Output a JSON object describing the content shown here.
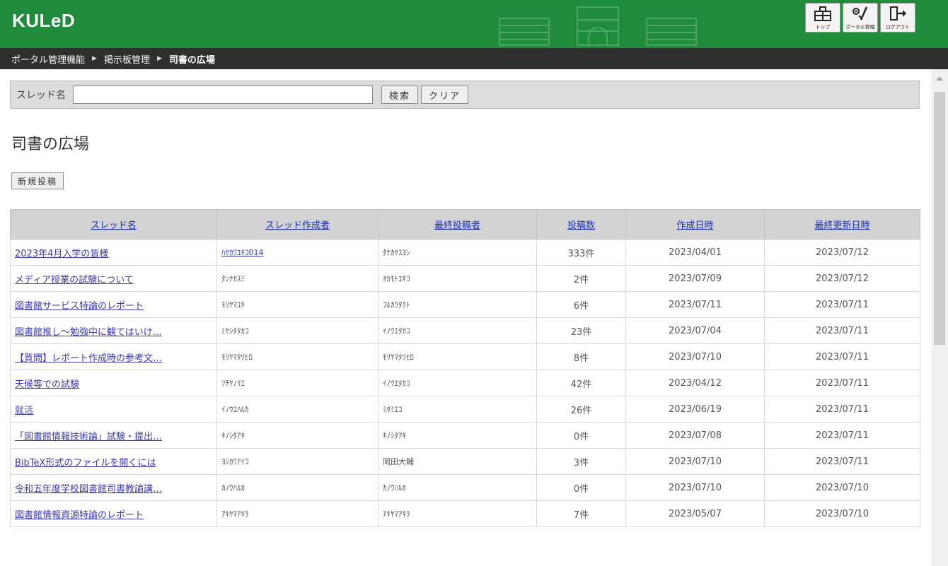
{
  "header": {
    "logo": "KULeD",
    "buttons": [
      {
        "icon": "top-icon",
        "label": "トップ"
      },
      {
        "icon": "tools-icon",
        "label": "ポータル管理"
      },
      {
        "icon": "logout-icon",
        "label": "ログアウト"
      }
    ]
  },
  "breadcrumb": {
    "items": [
      "ポータル管理機能",
      "掲示板管理",
      "司書の広場"
    ]
  },
  "search": {
    "label": "スレッド名",
    "value": "",
    "search_button": "検索",
    "clear_button": "クリア"
  },
  "page": {
    "title": "司書の広場",
    "new_post_button": "新規投稿"
  },
  "table": {
    "columns": [
      "スレッド名",
      "スレッド作成者",
      "最終投稿者",
      "投稿数",
      "作成日時",
      "最終更新日時"
    ],
    "rows": [
      {
        "name": "2023年4月入学の皆様",
        "creator": "ﾊﾔｶﾜﾕｷｺ014",
        "last": "ﾀﾅｶﾔｽﾖｼ",
        "count": "333件",
        "created": "2023/04/01",
        "updated": "2023/07/12"
      },
      {
        "name": "メディア授業の試験について",
        "creator": "ﾀﾝﾅｶｽﾐ",
        "last": "ｵｶﾓﾄﾕｷｺ",
        "count": "2件",
        "created": "2023/07/09",
        "updated": "2023/07/12"
      },
      {
        "name": "図書館サービス特論のレポート",
        "creator": "ﾓﾘﾔﾏﾕｷ",
        "last": "ﾌﾙｶﾜﾀｸﾄ",
        "count": "6件",
        "created": "2023/07/11",
        "updated": "2023/07/11"
      },
      {
        "name": "図書館推し～勉強中に観てはいけ…",
        "creator": "ﾐﾔｼﾀﾀｶｺ",
        "last": "ｲﾉｳｴﾀｶｺ",
        "count": "23件",
        "created": "2023/07/04",
        "updated": "2023/07/11"
      },
      {
        "name": "【質問】レポート作成時の参考文…",
        "creator": "ﾓﾘﾔﾏﾀﾂﾋﾛ",
        "last": "ﾓﾘﾔﾏﾀﾂﾋﾛ",
        "count": "8件",
        "created": "2023/07/10",
        "updated": "2023/07/11"
      },
      {
        "name": "天候等での試験",
        "creator": "ﾂﾁﾔﾉﾘｴ",
        "last": "ｲﾉｳｴﾀｶｺ",
        "count": "42件",
        "created": "2023/04/12",
        "updated": "2023/07/11"
      },
      {
        "name": "就活",
        "creator": "ｲﾉｳｴﾊﾙｶ",
        "last": "ﾐﾀﾐｴｺ",
        "count": "26件",
        "created": "2023/06/19",
        "updated": "2023/07/11"
      },
      {
        "name": "「図書館情報技術論」試験・提出…",
        "creator": "ｷﾉｼﾀｱｷ",
        "last": "ｷﾉｼﾀｱｷ",
        "count": "0件",
        "created": "2023/07/08",
        "updated": "2023/07/11"
      },
      {
        "name": "BibTeX形式のファイルを開くには",
        "creator": "ﾖｼｶﾜｱｲｺ",
        "last": "岡田大輔",
        "count": "3件",
        "created": "2023/07/10",
        "updated": "2023/07/11"
      },
      {
        "name": "令和五年度学校図書館司書教諭講…",
        "creator": "ｶﾉｳﾊﾙｶ",
        "last": "ｶﾉｳﾊﾙｶ",
        "count": "0件",
        "created": "2023/07/10",
        "updated": "2023/07/10"
      },
      {
        "name": "図書館情報資源特論のレポート",
        "creator": "ｱｷﾔﾏｱｷﾗ",
        "last": "ｱｷﾔﾏｱｷﾗ",
        "count": "7件",
        "created": "2023/05/07",
        "updated": "2023/07/10"
      }
    ]
  }
}
